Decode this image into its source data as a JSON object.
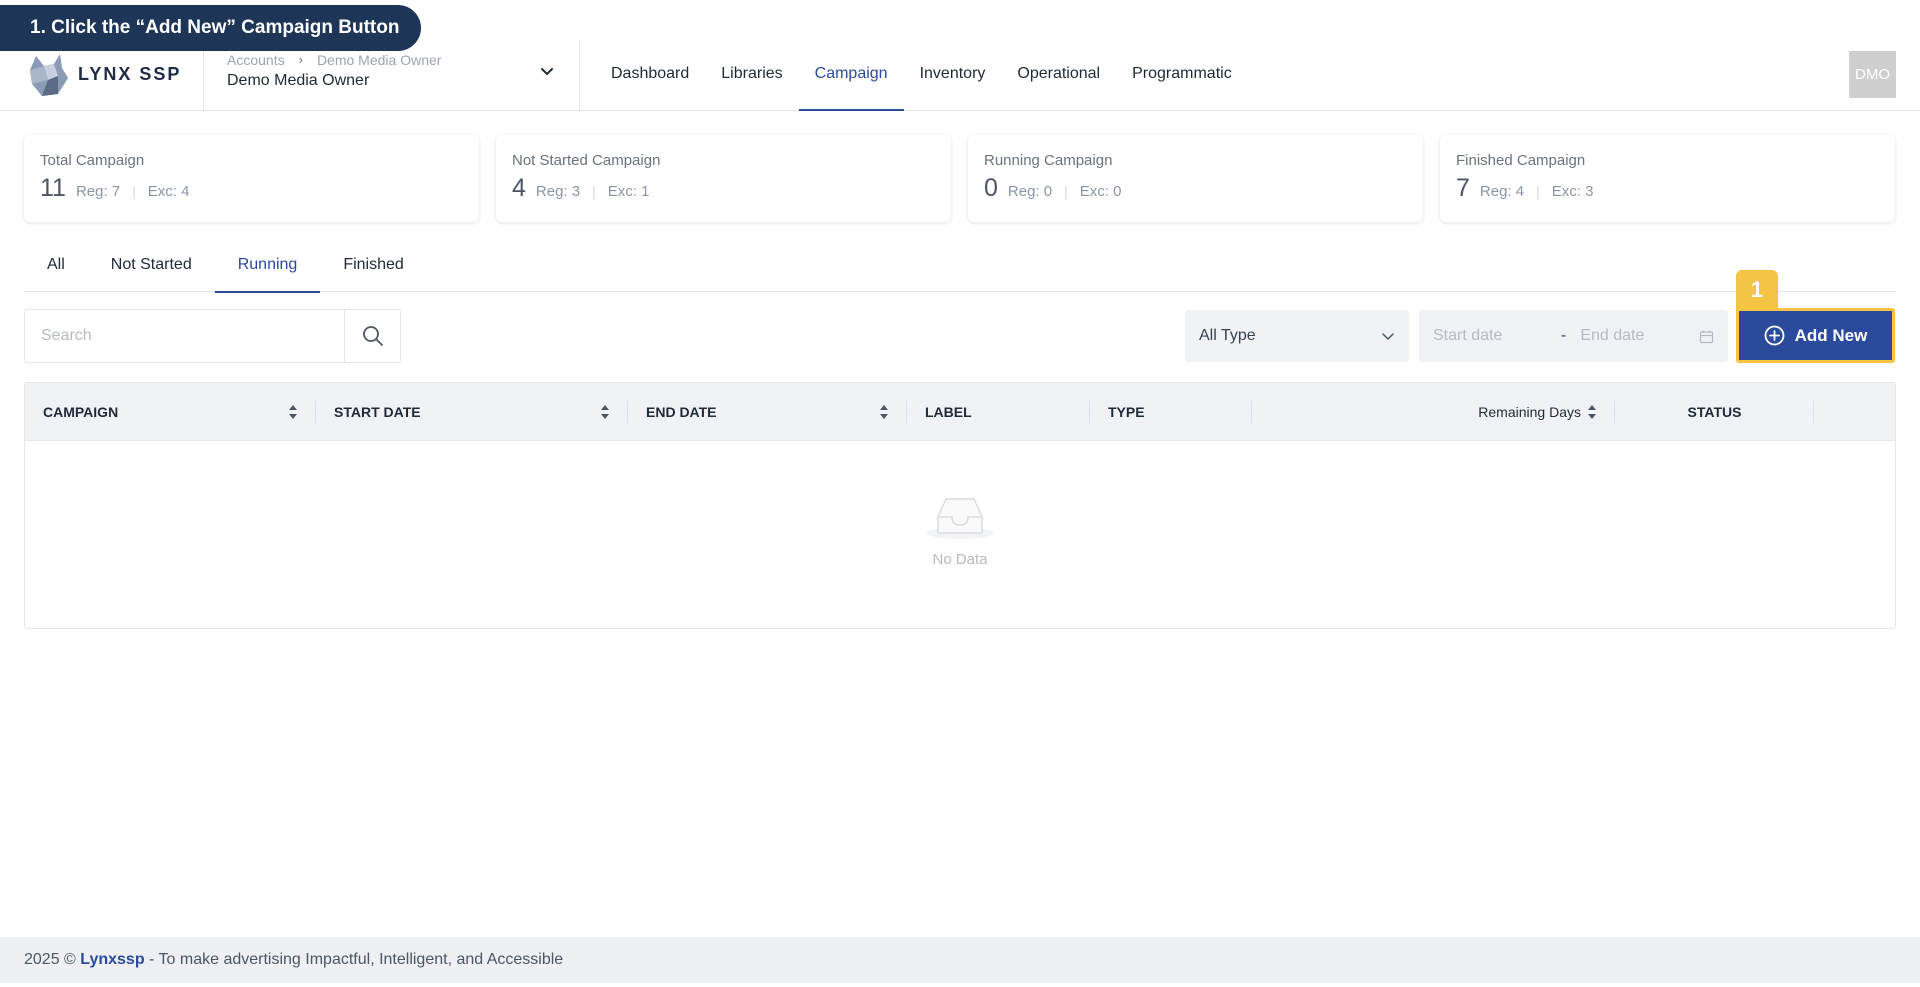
{
  "tutorial": {
    "text": "1. Click the “Add New” Campaign Button"
  },
  "header": {
    "logo_text": "LYNX SSP",
    "breadcrumb": [
      "Accounts",
      "Demo Media Owner"
    ],
    "breadcrumb_separator": "›",
    "account_name": "Demo Media Owner",
    "nav": [
      "Dashboard",
      "Libraries",
      "Campaign",
      "Inventory",
      "Operational",
      "Programmatic"
    ],
    "active_nav": "Campaign",
    "avatar": "DMO"
  },
  "stats": [
    {
      "title": "Total Campaign",
      "count": "11",
      "reg": "Reg: 7",
      "exc": "Exc: 4"
    },
    {
      "title": "Not Started Campaign",
      "count": "4",
      "reg": "Reg: 3",
      "exc": "Exc: 1"
    },
    {
      "title": "Running Campaign",
      "count": "0",
      "reg": "Reg: 0",
      "exc": "Exc: 0"
    },
    {
      "title": "Finished Campaign",
      "count": "7",
      "reg": "Reg: 4",
      "exc": "Exc: 3"
    }
  ],
  "tabs": [
    "All",
    "Not Started",
    "Running",
    "Finished"
  ],
  "active_tab": "Running",
  "search": {
    "placeholder": "Search"
  },
  "filters": {
    "type_value": "All Type",
    "start_placeholder": "Start date",
    "dash": "-",
    "end_placeholder": "End date"
  },
  "step_badge": "1",
  "add_button": "Add New",
  "table": {
    "columns": [
      "CAMPAIGN",
      "START DATE",
      "END DATE",
      "LABEL",
      "TYPE",
      "Remaining Days",
      "STATUS"
    ],
    "empty_text": "No Data"
  },
  "footer": {
    "prefix": "2025 © ",
    "brand": "Lynxssp",
    "suffix": " - To make advertising Impactful, Intelligent, and Accessible"
  },
  "colors": {
    "primary": "#2b4a9c",
    "highlight": "#f6c445",
    "tutorial_bg": "#1d3557"
  }
}
